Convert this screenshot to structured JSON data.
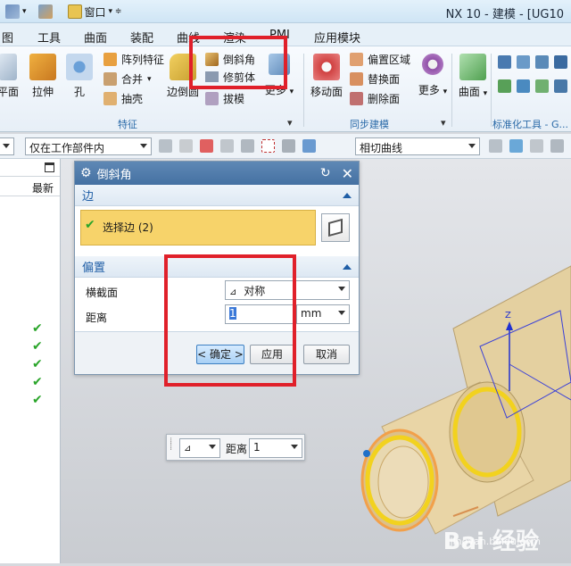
{
  "titlebar": {
    "window_menu": "窗口",
    "title": "NX 10 - 建模 - [UG10"
  },
  "menubar": {
    "items": [
      "图",
      "工具",
      "曲面",
      "装配",
      "曲线",
      "渲染",
      "PMI",
      "应用模块"
    ]
  },
  "ribbon": {
    "tools": {
      "datum_plane": "平面",
      "extrude": "拉伸",
      "hole": "孔",
      "pattern_feature": "阵列特征",
      "unite": "合并",
      "shell": "抽壳",
      "edge_blend": "边倒圆",
      "chamfer": "倒斜角",
      "trim_body": "修剪体",
      "draft": "拔模",
      "more_feature": "更多",
      "move_face": "移动面",
      "offset_region": "偏置区域",
      "replace_face": "替换面",
      "delete_face": "删除面",
      "more_sync": "更多",
      "surface": "曲面"
    },
    "groups": {
      "feature": "特征",
      "sync_modeling": "同步建模",
      "standardization": "标准化工具 - G..."
    }
  },
  "selbar": {
    "scope": "仅在工作部件内",
    "curve_rule": "相切曲线"
  },
  "leftpanel": {
    "column_header": "最新",
    "checks": [
      true,
      true,
      true,
      true,
      true
    ]
  },
  "dialog": {
    "title": "倒斜角",
    "edge_section": "边",
    "select_edge": "选择边 (2)",
    "offset_section": "偏置",
    "cross_section_label": "横截面",
    "cross_section_value": "对称",
    "distance_label": "距离",
    "distance_value": "1",
    "distance_unit": "mm",
    "ok": "< 确定 >",
    "apply": "应用",
    "cancel": "取消"
  },
  "floatbar": {
    "distance_label": "距离",
    "distance_value": "1"
  },
  "viewport": {
    "axis_z": "Z"
  },
  "watermark": {
    "brand": "Bai 经验",
    "url": "jingyan.baidu.com"
  },
  "colors": {
    "highlight_red": "#e0202a",
    "selected_edge_yellow": "#f2d21e",
    "part_body": "#e8d3a2",
    "dialog_title": "#4f7bab",
    "select_row": "#f7d36a"
  }
}
